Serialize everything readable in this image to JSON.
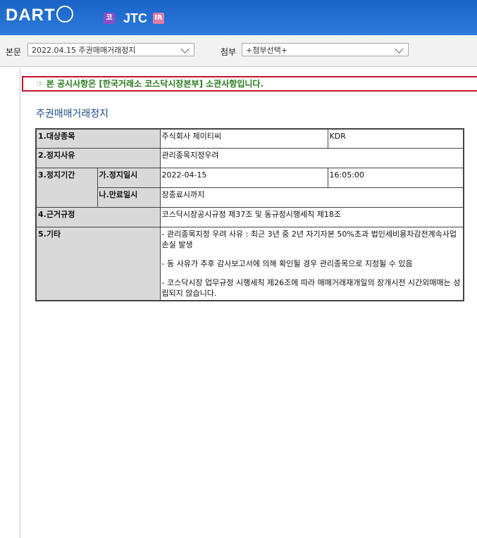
{
  "header": {
    "logo": "DART",
    "badge_ko": "코",
    "company": "JTC",
    "badge_ir": "IR"
  },
  "toolbar": {
    "body_label": "본문",
    "body_select": "2022.04.15  주권매매거래정지",
    "attach_label": "첨부",
    "attach_select": "+첨부선택+"
  },
  "doc": {
    "notice": "본 공시사항은 [한국거래소 코스닥시장본부] 소관사항입니다.",
    "notice_icon": "☞",
    "title": "주권매매거래정지",
    "rows": {
      "r1_label": "1.대상종목",
      "r1_value": "주식회사 제이티씨",
      "r1_extra": "KDR",
      "r2_label": "2.정지사유",
      "r2_value": "관리종목지정우려",
      "r3_label": "3.정지기간",
      "r3a_label": "가.정지일시",
      "r3a_date": "2022-04-15",
      "r3a_time": "16:05:00",
      "r3b_label": "나.만료일시",
      "r3b_value": "장종료시까지",
      "r4_label": "4.근거규정",
      "r4_value": "코스닥시장공시규정 제37조 및 동규정시행세칙 제18조",
      "r5_label": "5.기타",
      "r5_line1": "- 관리종목지정 우려 사유 : 최근 3년 중 2년 자기자본 50%초과 법인세비용차감전계속사업손실 발생",
      "r5_line2": "- 동 사유가 추후 감사보고서에 의해 확인될 경우 관리종목으로 지정될 수 있음",
      "r5_line3": "- 코스닥시장 업무규정 시행세칙 제26조에 따라 매매거래재개일의 장개시전 시간외매매는 성립되지 않습니다."
    }
  },
  "colors": {
    "header_blue": "#2d7bdc",
    "notice_border": "#c8102e",
    "notice_text": "#2a7a1e",
    "title_blue": "#1a4a8a"
  }
}
